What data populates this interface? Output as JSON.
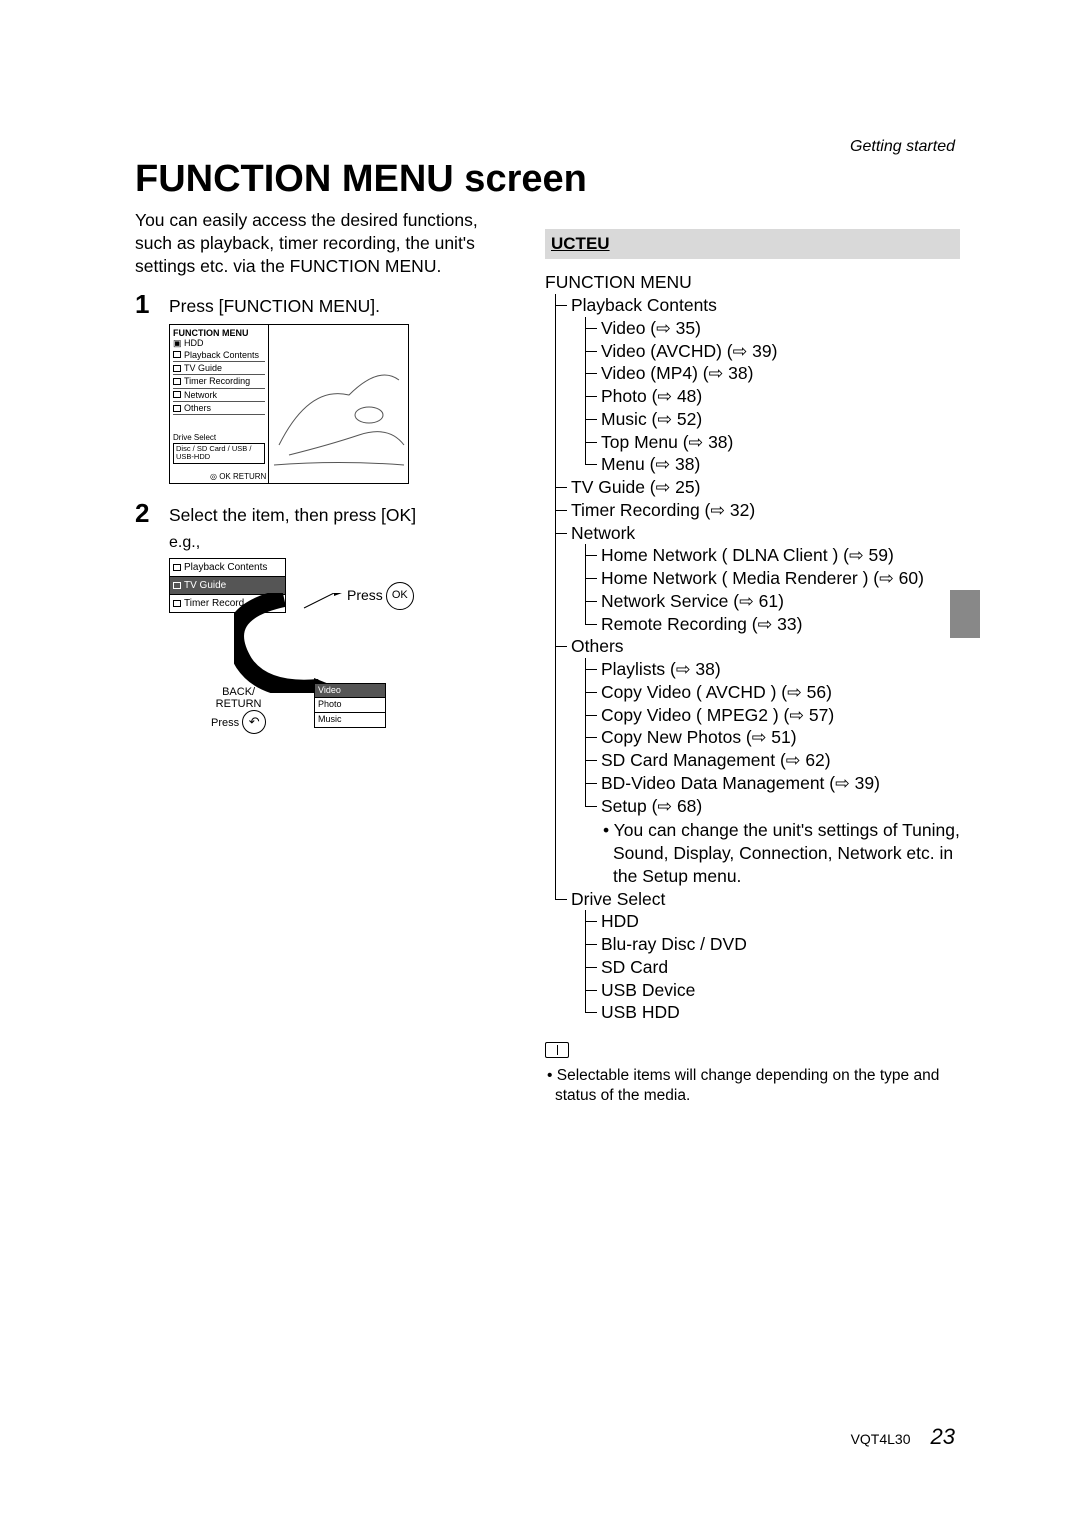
{
  "header": {
    "section": "Getting started"
  },
  "title": "FUNCTION MENU screen",
  "intro": "You can easily access the desired functions, such as playback, timer recording, the unit's settings etc. via the FUNCTION MENU.",
  "steps": {
    "s1": {
      "num": "1",
      "text": "Press [FUNCTION MENU]."
    },
    "s2": {
      "num": "2",
      "text": "Select the item, then press [OK]"
    }
  },
  "screenshot": {
    "title": "FUNCTION MENU",
    "subtitle": "HDD",
    "rows": [
      "Playback Contents",
      "TV Guide",
      "Timer Recording",
      "Network",
      "Others"
    ],
    "drive_label": "Drive Select",
    "drive_value": "Disc / SD Card / USB / USB-HDD",
    "hint": "OK  RETURN"
  },
  "diagram2": {
    "eg": "e.g.,",
    "list": [
      "Playback Contents",
      "TV Guide",
      "Timer Record..."
    ],
    "press": "Press",
    "ok": "OK",
    "back": "BACK/",
    "return_": "RETURN",
    "press2": "Press",
    "submenu": [
      "Video",
      "Photo",
      "Music"
    ]
  },
  "ucteu": {
    "label": "UCTEU",
    "root": "FUNCTION MENU",
    "tree": {
      "playback": {
        "label": "Playback Contents",
        "items": {
          "video": "Video (⇨ 35)",
          "video_avchd": "Video (AVCHD) (⇨ 39)",
          "video_mp4": "Video (MP4) (⇨ 38)",
          "photo": "Photo (⇨ 48)",
          "music": "Music (⇨ 52)",
          "top_menu": "Top Menu (⇨ 38)",
          "menu": "Menu (⇨ 38)"
        }
      },
      "tv_guide": "TV Guide (⇨ 25)",
      "timer_rec": "Timer Recording (⇨ 32)",
      "network": {
        "label": "Network",
        "items": {
          "dlna": "Home Network ( DLNA Client ) (⇨ 59)",
          "media_renderer": "Home Network ( Media Renderer ) (⇨ 60)",
          "net_service": "Network Service (⇨ 61)",
          "remote_rec": "Remote Recording (⇨ 33)"
        }
      },
      "others": {
        "label": "Others",
        "items": {
          "playlists": "Playlists (⇨ 38)",
          "copy_avchd": "Copy Video ( AVCHD ) (⇨ 56)",
          "copy_mpeg2": "Copy Video ( MPEG2 ) (⇨ 57)",
          "copy_photos": "Copy New Photos (⇨ 51)",
          "sd_mgmt": "SD Card Management (⇨ 62)",
          "bd_mgmt": "BD-Video Data Management (⇨ 39)",
          "setup": "Setup (⇨ 68)",
          "setup_note": "• You can change the unit's settings of Tuning, Sound, Display, Connection, Network etc. in the Setup menu."
        }
      },
      "drive_select": {
        "label": "Drive Select",
        "items": {
          "hdd": "HDD",
          "bd_dvd": "Blu-ray Disc / DVD",
          "sd": "SD Card",
          "usb_dev": "USB Device",
          "usb_hdd": "USB HDD"
        }
      }
    }
  },
  "note": "• Selectable items will change depending on the type and status of the media.",
  "footer": {
    "code": "VQT4L30",
    "page": "23"
  }
}
